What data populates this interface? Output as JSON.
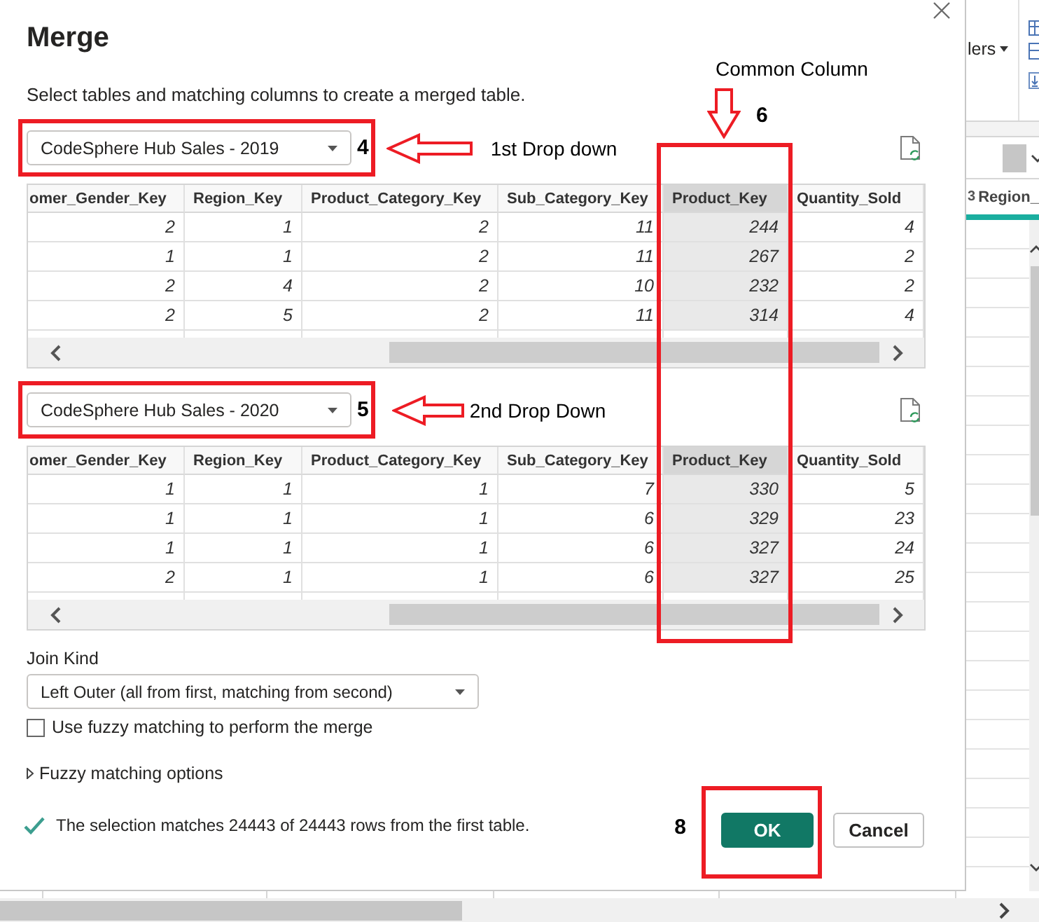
{
  "dialog": {
    "title": "Merge",
    "description": "Select tables and matching columns to create a merged table.",
    "tables": [
      {
        "source": "CodeSphere Hub Sales - 2019",
        "callout": {
          "number": "4",
          "label": "1st Drop down"
        },
        "columns": [
          {
            "label": "omer_Gender_Key",
            "selected": false
          },
          {
            "label": "Region_Key",
            "selected": false
          },
          {
            "label": "Product_Category_Key",
            "selected": false
          },
          {
            "label": "Sub_Category_Key",
            "selected": false
          },
          {
            "label": "Product_Key",
            "selected": true
          },
          {
            "label": "Quantity_Sold",
            "selected": false
          }
        ],
        "rows": [
          [
            "2",
            "1",
            "2",
            "11",
            "244",
            "4"
          ],
          [
            "1",
            "1",
            "2",
            "11",
            "267",
            "2"
          ],
          [
            "2",
            "4",
            "2",
            "10",
            "232",
            "2"
          ],
          [
            "2",
            "5",
            "2",
            "11",
            "314",
            "4"
          ]
        ]
      },
      {
        "source": "CodeSphere Hub Sales - 2020",
        "callout": {
          "number": "5",
          "label": "2nd Drop Down"
        },
        "columns": [
          {
            "label": "omer_Gender_Key",
            "selected": false
          },
          {
            "label": "Region_Key",
            "selected": false
          },
          {
            "label": "Product_Category_Key",
            "selected": false
          },
          {
            "label": "Sub_Category_Key",
            "selected": false
          },
          {
            "label": "Product_Key",
            "selected": true
          },
          {
            "label": "Quantity_Sold",
            "selected": false
          }
        ],
        "rows": [
          [
            "1",
            "1",
            "1",
            "7",
            "330",
            "5"
          ],
          [
            "1",
            "1",
            "1",
            "6",
            "329",
            "23"
          ],
          [
            "1",
            "1",
            "1",
            "6",
            "327",
            "24"
          ],
          [
            "2",
            "1",
            "1",
            "6",
            "327",
            "25"
          ]
        ]
      }
    ],
    "column_callout": {
      "label": "Common Column",
      "number": "6"
    },
    "join_kind": {
      "label": "Join Kind",
      "value": "Left Outer (all from first, matching from second)"
    },
    "fuzzy_matching": {
      "label": "Use fuzzy matching to perform the merge",
      "checked": false
    },
    "fuzzy_options": {
      "label": "Fuzzy matching options",
      "expanded": false
    },
    "status": "The selection matches 24443 of 24443 rows from the first table.",
    "buttons": [
      {
        "label": "OK",
        "kind": "primary",
        "callout": {
          "number": "8"
        }
      },
      {
        "label": "Cancel",
        "kind": "secondary"
      }
    ]
  },
  "background_app": {
    "ribbon_button": "lers",
    "column_header": {
      "type_icon_text": "3",
      "label": "Region_"
    }
  }
}
